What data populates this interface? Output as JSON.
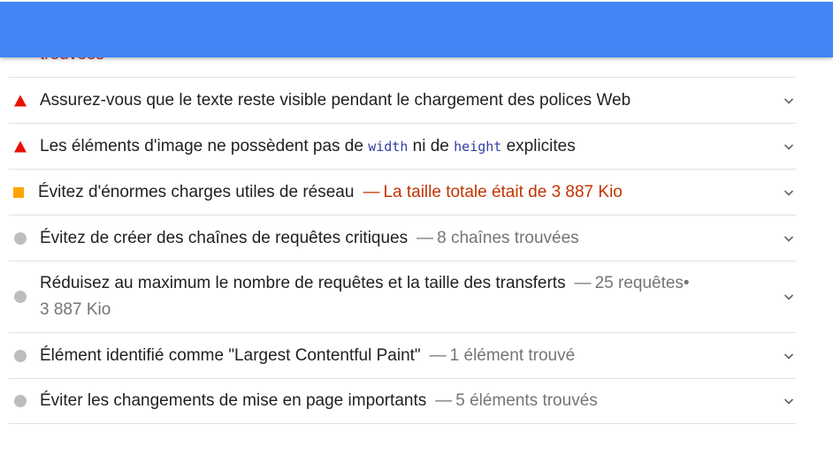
{
  "top_bar": {
    "color": "#4285f4"
  },
  "cut_off_text": "trouvées",
  "audits": [
    {
      "status": "fail",
      "title": "Assurez-vous que le texte reste visible pendant le chargement des polices Web",
      "display": ""
    },
    {
      "status": "fail",
      "title_prefix": "Les éléments d'image ne possèdent pas de",
      "code1": "width",
      "title_mid": "ni de",
      "code2": "height",
      "title_suffix": "explicites",
      "display": ""
    },
    {
      "status": "average",
      "title": "Évitez d'énormes charges utiles de réseau",
      "display": "La taille totale était de 3 887 Kio"
    },
    {
      "status": "info",
      "title": "Évitez de créer des chaînes de requêtes critiques",
      "display": "8 chaînes trouvées"
    },
    {
      "status": "info",
      "title": "Réduisez au maximum le nombre de requêtes et la taille des transferts",
      "display": "25 requêtes•",
      "display_line2": "3 887 Kio"
    },
    {
      "status": "info",
      "title": "Élément identifié comme \"Largest Contentful Paint\"",
      "display": "1 élément trouvé"
    },
    {
      "status": "info",
      "title": "Éviter les changements de mise en page importants",
      "display": "5 éléments trouvés"
    }
  ],
  "dash": "—",
  "icons": {
    "fail": "red-triangle-icon",
    "average": "orange-square-icon",
    "info": "gray-circle-icon",
    "expand": "chevron-down-icon"
  },
  "colors": {
    "fail": "#eb0f00",
    "average": "#ffa400",
    "info": "#bdbdbd",
    "average_text": "#c33300"
  }
}
